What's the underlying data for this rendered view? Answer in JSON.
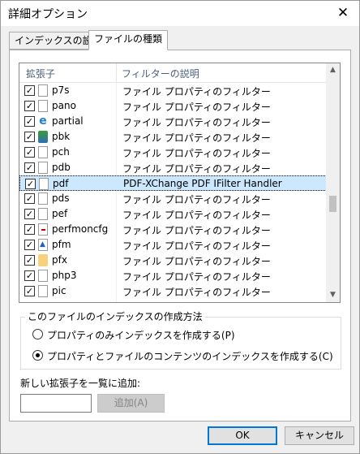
{
  "window": {
    "title": "詳細オプション",
    "close": "✕"
  },
  "tabs": [
    {
      "label": "インデックスの設定"
    },
    {
      "label": "ファイルの種類"
    }
  ],
  "list": {
    "col_ext": "拡張子",
    "col_filter": "フィルターの説明",
    "rows": [
      {
        "ext": "p7s",
        "filter": "ファイル プロパティのフィルター",
        "checked": true,
        "icon": "blank-file-icon"
      },
      {
        "ext": "pano",
        "filter": "ファイル プロパティのフィルター",
        "checked": true,
        "icon": "blank-file-icon"
      },
      {
        "ext": "partial",
        "filter": "ファイル プロパティのフィルター",
        "checked": true,
        "icon": "ie-file-icon"
      },
      {
        "ext": "pbk",
        "filter": "ファイル プロパティのフィルター",
        "checked": true,
        "icon": "network-file-icon"
      },
      {
        "ext": "pch",
        "filter": "ファイル プロパティのフィルター",
        "checked": true,
        "icon": "blank-file-icon"
      },
      {
        "ext": "pdb",
        "filter": "ファイル プロパティのフィルター",
        "checked": true,
        "icon": "blank-file-icon"
      },
      {
        "ext": "pdf",
        "filter": "PDF-XChange PDF IFilter Handler",
        "checked": true,
        "icon": "blank-file-icon",
        "selected": true
      },
      {
        "ext": "pds",
        "filter": "ファイル プロパティのフィルター",
        "checked": true,
        "icon": "blank-file-icon"
      },
      {
        "ext": "pef",
        "filter": "ファイル プロパティのフィルター",
        "checked": true,
        "icon": "blank-file-icon"
      },
      {
        "ext": "perfmoncfg",
        "filter": "ファイル プロパティのフィルター",
        "checked": true,
        "icon": "config-file-icon"
      },
      {
        "ext": "pfm",
        "filter": "ファイル プロパティのフィルター",
        "checked": true,
        "icon": "font-file-icon"
      },
      {
        "ext": "pfx",
        "filter": "ファイル プロパティのフィルター",
        "checked": true,
        "icon": "certificate-file-icon"
      },
      {
        "ext": "php3",
        "filter": "ファイル プロパティのフィルター",
        "checked": true,
        "icon": "blank-file-icon"
      },
      {
        "ext": "pic",
        "filter": "ファイル プロパティのフィルター",
        "checked": true,
        "icon": "blank-file-icon"
      }
    ],
    "scroll_up": "▲",
    "scroll_down": "▼"
  },
  "index_method": {
    "label": "このファイルのインデックスの作成方法",
    "opt_props": "プロパティのみインデックスを作成する(P)",
    "opt_contents": "プロパティとファイルのコンテンツのインデックスを作成する(C)",
    "selected": "opt_contents"
  },
  "add_ext": {
    "label": "新しい拡張子を一覧に追加:",
    "value": "",
    "button": "追加(A)"
  },
  "buttons": {
    "ok": "OK",
    "cancel": "キャンセル"
  },
  "colors": {
    "selection": "#cce8ff",
    "accent": "#0078d7"
  }
}
